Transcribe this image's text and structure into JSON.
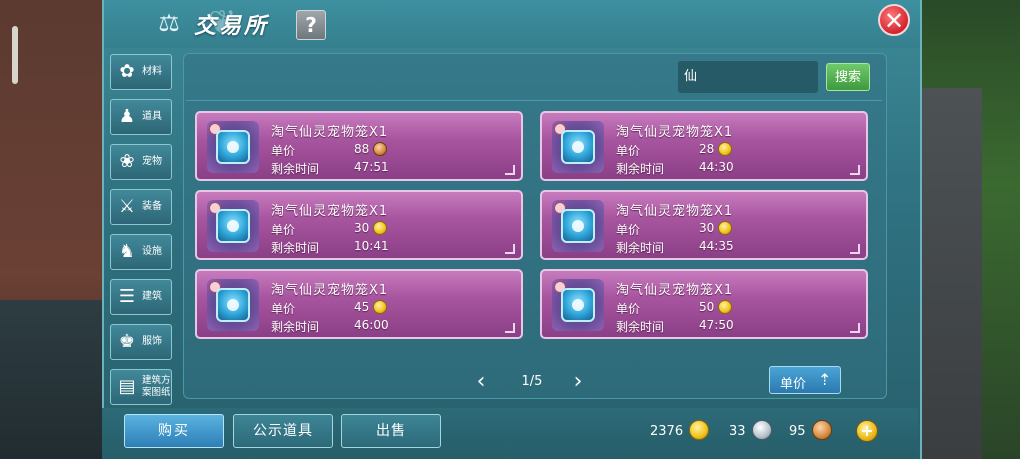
{
  "header": {
    "title": "交易所",
    "help_label": "?",
    "close_label": "✕"
  },
  "sidebar": {
    "items": [
      {
        "label": "材料",
        "icon": "materials-icon",
        "glyph": "✿"
      },
      {
        "label": "道具",
        "icon": "potion-icon",
        "glyph": "♟"
      },
      {
        "label": "宠物",
        "icon": "paw-icon",
        "glyph": "❀"
      },
      {
        "label": "装备",
        "icon": "sword-icon",
        "glyph": "⚔"
      },
      {
        "label": "设施",
        "icon": "facility-icon",
        "glyph": "♞"
      },
      {
        "label": "建筑",
        "icon": "building-icon",
        "glyph": "☰"
      },
      {
        "label": "服饰",
        "icon": "clothing-icon",
        "glyph": "♚"
      },
      {
        "label": "建筑方案图纸",
        "icon": "blueprint-icon",
        "glyph": "▤"
      }
    ]
  },
  "search": {
    "value": "仙",
    "button_label": "搜索"
  },
  "listing": {
    "price_label": "单价",
    "time_label": "剩余时间",
    "items": [
      {
        "name": "淘气仙灵宠物笼X1",
        "price": "88",
        "coin": "bronze",
        "time": "47:51"
      },
      {
        "name": "淘气仙灵宠物笼X1",
        "price": "28",
        "coin": "gold",
        "time": "44:30"
      },
      {
        "name": "淘气仙灵宠物笼X1",
        "price": "30",
        "coin": "gold",
        "time": "10:41"
      },
      {
        "name": "淘气仙灵宠物笼X1",
        "price": "30",
        "coin": "gold",
        "time": "44:35"
      },
      {
        "name": "淘气仙灵宠物笼X1",
        "price": "45",
        "coin": "gold",
        "time": "46:00"
      },
      {
        "name": "淘气仙灵宠物笼X1",
        "price": "50",
        "coin": "gold",
        "time": "47:50"
      }
    ]
  },
  "pager": {
    "text": "1/5"
  },
  "sort": {
    "label": "单价"
  },
  "actions": {
    "buy": "购买",
    "public_items": "公示道具",
    "sell": "出售"
  },
  "currency": {
    "gold": "2376",
    "silver": "33",
    "bronze": "95"
  },
  "colors": {
    "panel": "#2f7180",
    "card": "#a8559f",
    "search_button": "#4fae4c",
    "buy_button": "#3a8fc6",
    "close_button": "#d3232e"
  }
}
